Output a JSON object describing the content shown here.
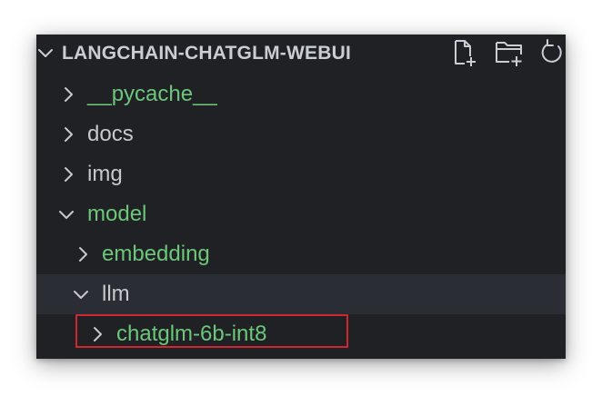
{
  "explorer": {
    "title": "LANGCHAIN-CHATGLM-WEBUI",
    "actions": [
      {
        "name": "new-file-icon"
      },
      {
        "name": "new-folder-icon"
      },
      {
        "name": "refresh-icon"
      }
    ]
  },
  "tree": {
    "items": [
      {
        "label": "__pycache__",
        "expanded": false,
        "color": "#6cc77a"
      },
      {
        "label": "docs",
        "expanded": false,
        "color": "#c7c9cc"
      },
      {
        "label": "img",
        "expanded": false,
        "color": "#c7c9cc"
      },
      {
        "label": "model",
        "expanded": true,
        "color": "#6cc77a"
      },
      {
        "label": "embedding",
        "expanded": false,
        "color": "#6cc77a"
      },
      {
        "label": "llm",
        "expanded": true,
        "color": "#c7c9cc",
        "selected": true
      },
      {
        "label": "chatglm-6b-int8",
        "expanded": false,
        "color": "#6cc77a",
        "annotated": true
      }
    ]
  },
  "colors": {
    "background": "#1f2125",
    "selected_row": "#2a2d33",
    "untracked_green": "#6cc77a",
    "annotation_red": "#d0262d"
  }
}
